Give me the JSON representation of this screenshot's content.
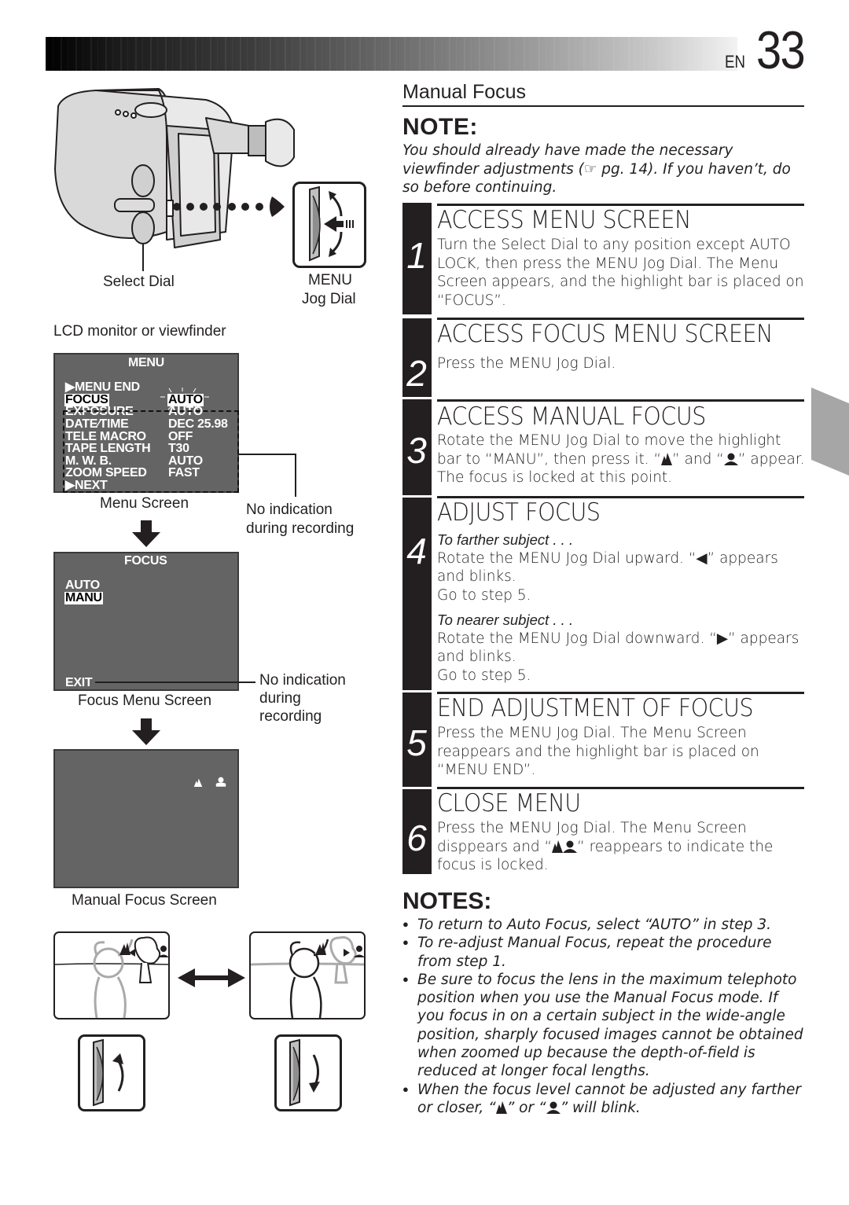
{
  "header": {
    "lang": "EN",
    "page_number": "33"
  },
  "section_title": "Manual Focus",
  "note": {
    "heading": "NOTE:",
    "text": "You should already have made the necessary viewfinder adjustments (☞ pg. 14). If you haven’t, do so before continuing."
  },
  "steps": [
    {
      "number": "1",
      "title": "ACCESS MENU SCREEN",
      "text": "Turn the Select Dial to any position except AUTO LOCK, then press the MENU Jog Dial. The Menu Screen appears, and the highlight bar is placed on “FOCUS”."
    },
    {
      "number": "2",
      "title": "ACCESS FOCUS MENU SCREEN",
      "text": "Press the MENU Jog Dial."
    },
    {
      "number": "3",
      "title": "ACCESS MANUAL FOCUS",
      "text_a": "Rotate the MENU Jog Dial to move the highlight bar to “MANU”, then press it. “",
      "text_b": "” and “",
      "text_c": "” appear. The focus is locked at this point."
    },
    {
      "number": "4",
      "title": "ADJUST FOCUS",
      "farther_label": "To farther subject . . .",
      "farther_text_a": "Rotate the MENU Jog Dial upward. “◀” appears and blinks.",
      "farther_goto": "Go to step 5.",
      "nearer_label": "To nearer subject . . .",
      "nearer_text_a": "Rotate the MENU Jog Dial downward. “▶” appears and blinks.",
      "nearer_goto": "Go to step 5."
    },
    {
      "number": "5",
      "title": "END ADJUSTMENT OF FOCUS",
      "text": "Press the MENU Jog Dial. The Menu Screen reappears and the highlight bar is placed on “MENU END”."
    },
    {
      "number": "6",
      "title": "CLOSE MENU",
      "text_a": "Press the MENU Jog Dial. The Menu Screen disppears and “",
      "text_b": "” reappears to indicate the focus is locked."
    }
  ],
  "notes": {
    "heading": "NOTES:",
    "items": [
      "To return to Auto Focus, select “AUTO” in step 3.",
      "To re-adjust Manual Focus, repeat the procedure from step 1.",
      "Be sure to focus the lens in the maximum telephoto position when you use the Manual Focus mode. If you focus in on a certain subject in the wide-angle position, sharply focused images cannot be obtained when zoomed up because the depth-of-field is reduced at longer focal lengths."
    ],
    "last_item_a": "When the focus level cannot be adjusted any farther or closer, “",
    "last_item_b": "” or “",
    "last_item_c": "” will blink."
  },
  "figure": {
    "select_dial_label": "Select Dial",
    "menu_label": "MENU",
    "jog_dial_label": "Jog Dial",
    "lcd_label": "LCD monitor or viewfinder",
    "menu_screen": {
      "title": "MENU",
      "menu_end": "▶MENU  END",
      "focus_key": "FOCUS",
      "focus_value": "AUTO",
      "exposure_key": "EXPOSURE",
      "exposure_value": "AUTO",
      "rows": [
        {
          "key": "DATE⁄TIME",
          "value": "DEC  25.98"
        },
        {
          "key": "TELE  MACRO",
          "value": "OFF"
        },
        {
          "key": "TAPE  LENGTH",
          "value": "T30"
        },
        {
          "key": "M. W. B.",
          "value": "AUTO"
        },
        {
          "key": "ZOOM SPEED",
          "value": "FAST"
        },
        {
          "key": "▶NEXT",
          "value": ""
        }
      ],
      "caption": "Menu Screen",
      "callout": "No indication during recording"
    },
    "focus_screen": {
      "title": "FOCUS",
      "option_auto": "AUTO",
      "option_manu": "MANU",
      "exit": "EXIT",
      "caption": "Focus Menu Screen",
      "callout_1": "No indication",
      "callout_2": "during",
      "callout_3": "recording"
    },
    "manual_screen": {
      "caption": "Manual Focus Screen"
    }
  }
}
